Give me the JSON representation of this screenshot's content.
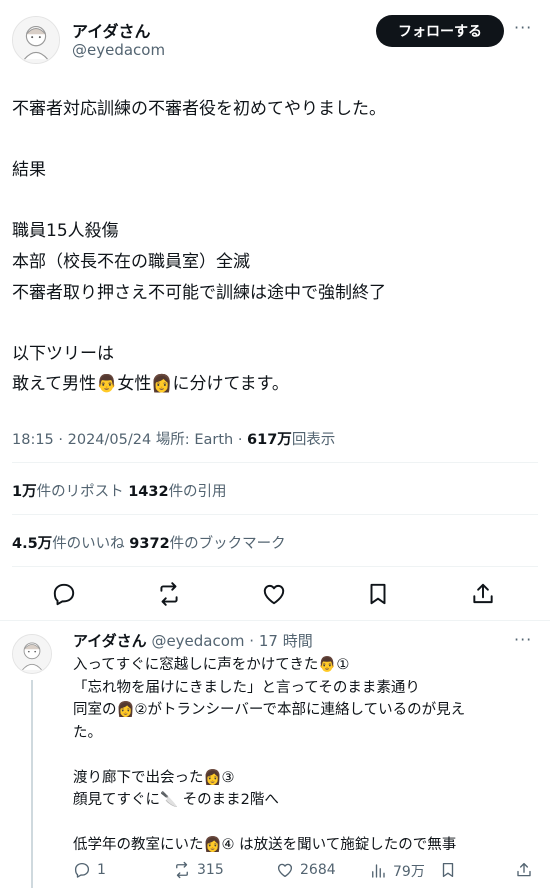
{
  "post": {
    "author_name": "アイダさん",
    "author_handle": "@eyedacom",
    "follow_label": "フォローする",
    "more_glyph": "···",
    "text_lines": [
      "不審者対応訓練の不審者役を初めてやりました。",
      "",
      "結果",
      "",
      "職員15人殺傷",
      "本部（校長不在の職員室）全滅",
      "不審者取り押さえ不可能で訓練は途中で強制終了",
      "",
      "以下ツリーは",
      "敢えて男性👨女性👩に分けてます。"
    ],
    "meta": {
      "time": "18:15",
      "date": "2024/05/24",
      "location_label": "場所:",
      "location": "Earth",
      "views": "617万",
      "views_label": "回表示"
    },
    "stats": {
      "reposts": "1万",
      "reposts_label": "件のリポスト",
      "quotes": "1432",
      "quotes_label": "件の引用",
      "likes": "4.5万",
      "likes_label": "件のいいね",
      "bookmarks": "9372",
      "bookmarks_label": "件のブックマーク"
    }
  },
  "reply": {
    "author_name": "アイダさん",
    "author_handle": "@eyedacom",
    "time_ago": "17 時間",
    "more_glyph": "···",
    "text_lines": [
      "入ってすぐに窓越しに声をかけてきた👨①",
      "「忘れ物を届けにきました」と言ってそのまま素通り",
      "同室の👩②がトランシーバーで本部に連絡しているのが見え",
      "た。",
      "",
      "渡り廊下で出会った👩③",
      "顔見てすぐに🔪 そのまま2階へ",
      "",
      "低学年の教室にいた👩④ は放送を聞いて施錠したので無事"
    ],
    "actions": {
      "replies": "1",
      "reposts": "315",
      "likes": "2684",
      "views": "79万"
    }
  },
  "icons": [
    "reply-icon",
    "repost-icon",
    "like-icon",
    "bookmark-icon",
    "share-icon",
    "views-icon"
  ]
}
